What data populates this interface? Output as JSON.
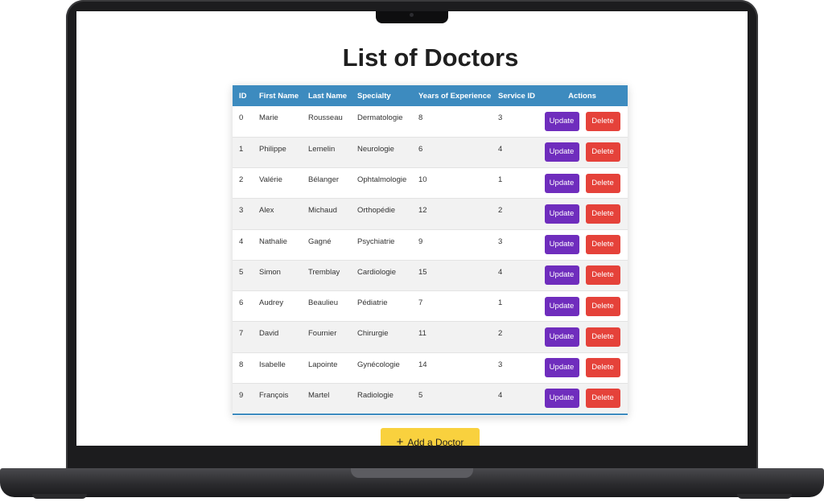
{
  "page": {
    "title": "List of Doctors"
  },
  "table": {
    "headers": [
      "ID",
      "First Name",
      "Last Name",
      "Specialty",
      "Years of Experience",
      "Service ID",
      "Actions"
    ],
    "rows": [
      {
        "id": "0",
        "first_name": "Marie",
        "last_name": "Rousseau",
        "specialty": "Dermatologie",
        "years": "8",
        "service_id": "3"
      },
      {
        "id": "1",
        "first_name": "Philippe",
        "last_name": "Lemelin",
        "specialty": "Neurologie",
        "years": "6",
        "service_id": "4"
      },
      {
        "id": "2",
        "first_name": "Valérie",
        "last_name": "Bélanger",
        "specialty": "Ophtalmologie",
        "years": "10",
        "service_id": "1"
      },
      {
        "id": "3",
        "first_name": "Alex",
        "last_name": "Michaud",
        "specialty": "Orthopédie",
        "years": "12",
        "service_id": "2"
      },
      {
        "id": "4",
        "first_name": "Nathalie",
        "last_name": "Gagné",
        "specialty": "Psychiatrie",
        "years": "9",
        "service_id": "3"
      },
      {
        "id": "5",
        "first_name": "Simon",
        "last_name": "Tremblay",
        "specialty": "Cardiologie",
        "years": "15",
        "service_id": "4"
      },
      {
        "id": "6",
        "first_name": "Audrey",
        "last_name": "Beaulieu",
        "specialty": "Pédiatrie",
        "years": "7",
        "service_id": "1"
      },
      {
        "id": "7",
        "first_name": "David",
        "last_name": "Fournier",
        "specialty": "Chirurgie",
        "years": "11",
        "service_id": "2"
      },
      {
        "id": "8",
        "first_name": "Isabelle",
        "last_name": "Lapointe",
        "specialty": "Gynécologie",
        "years": "14",
        "service_id": "3"
      },
      {
        "id": "9",
        "first_name": "François",
        "last_name": "Martel",
        "specialty": "Radiologie",
        "years": "5",
        "service_id": "4"
      }
    ],
    "update_label": "Update",
    "delete_label": "Delete"
  },
  "add_button": {
    "icon": "plus-icon",
    "label": "Add a Doctor"
  },
  "colors": {
    "header": "#3d8bbf",
    "update": "#6f2dbd",
    "delete": "#e5423a",
    "add": "#f9d13e"
  }
}
